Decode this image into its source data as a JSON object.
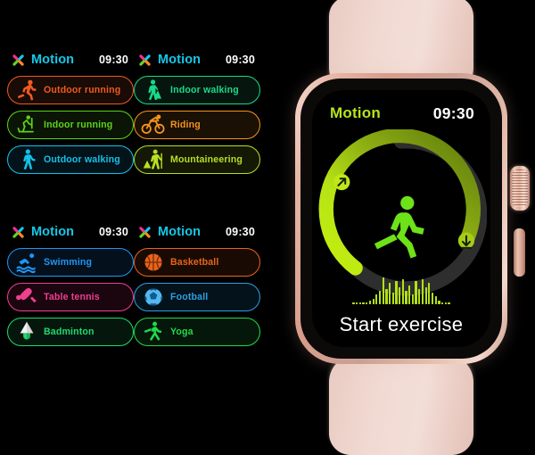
{
  "app": {
    "brand_logo": "x-logo-icon",
    "accent_cyan": "#15c8e8",
    "accent_lime": "#b6e31c"
  },
  "panels": [
    {
      "id": "panel-top-left",
      "title": "Motion",
      "time": "09:30",
      "items": [
        {
          "label": "Outdoor running",
          "icon": "running-icon",
          "color": "#f05a23"
        },
        {
          "label": "Indoor running",
          "icon": "treadmill-icon",
          "color": "#5fd31a"
        },
        {
          "label": "Outdoor walking",
          "icon": "walking-icon",
          "color": "#12c2e8"
        }
      ]
    },
    {
      "id": "panel-top-right",
      "title": "Motion",
      "time": "09:30",
      "items": [
        {
          "label": "Indoor walking",
          "icon": "indoor-walking-icon",
          "color": "#19d98a"
        },
        {
          "label": "Riding",
          "icon": "bicycle-icon",
          "color": "#f5941e"
        },
        {
          "label": "Mountaineering",
          "icon": "hiking-icon",
          "color": "#b6e024"
        }
      ]
    },
    {
      "id": "panel-bottom-left",
      "title": "Motion",
      "time": "09:30",
      "items": [
        {
          "label": "Swimming",
          "icon": "swimmer-icon",
          "color": "#2196f3"
        },
        {
          "label": "Table tennis",
          "icon": "pingpong-icon",
          "color": "#ef3f8f"
        },
        {
          "label": "Badminton",
          "icon": "shuttlecock-icon",
          "color": "#21d96b"
        }
      ]
    },
    {
      "id": "panel-bottom-right",
      "title": "Motion",
      "time": "09:30",
      "items": [
        {
          "label": "Basketball",
          "icon": "basketball-icon",
          "color": "#e8641c"
        },
        {
          "label": "Football",
          "icon": "soccerball-icon",
          "color": "#2e9fe0"
        },
        {
          "label": "Yoga",
          "icon": "yoga-icon",
          "color": "#22d94a"
        }
      ]
    }
  ],
  "watch": {
    "title": "Motion",
    "time": "09:30",
    "cta_label": "Start exercise",
    "runner_icon": "running-figure-icon",
    "start_marker_icon": "arrow-up-right-icon",
    "end_marker_icon": "arrow-down-icon",
    "ring": {
      "progress_color": "#b4e317",
      "track_color": "#6d8a10",
      "empty_color": "#2e2e2e",
      "progress_percent": 62
    },
    "waveform": [
      1,
      1,
      1,
      1,
      1,
      2,
      3,
      5,
      7,
      14,
      8,
      11,
      6,
      12,
      9,
      13,
      7,
      10,
      5,
      12,
      8,
      13,
      9,
      11,
      6,
      4,
      2,
      1,
      1,
      1
    ],
    "case_color": "#e0b3a2",
    "band_color": "#f0d6ce"
  }
}
